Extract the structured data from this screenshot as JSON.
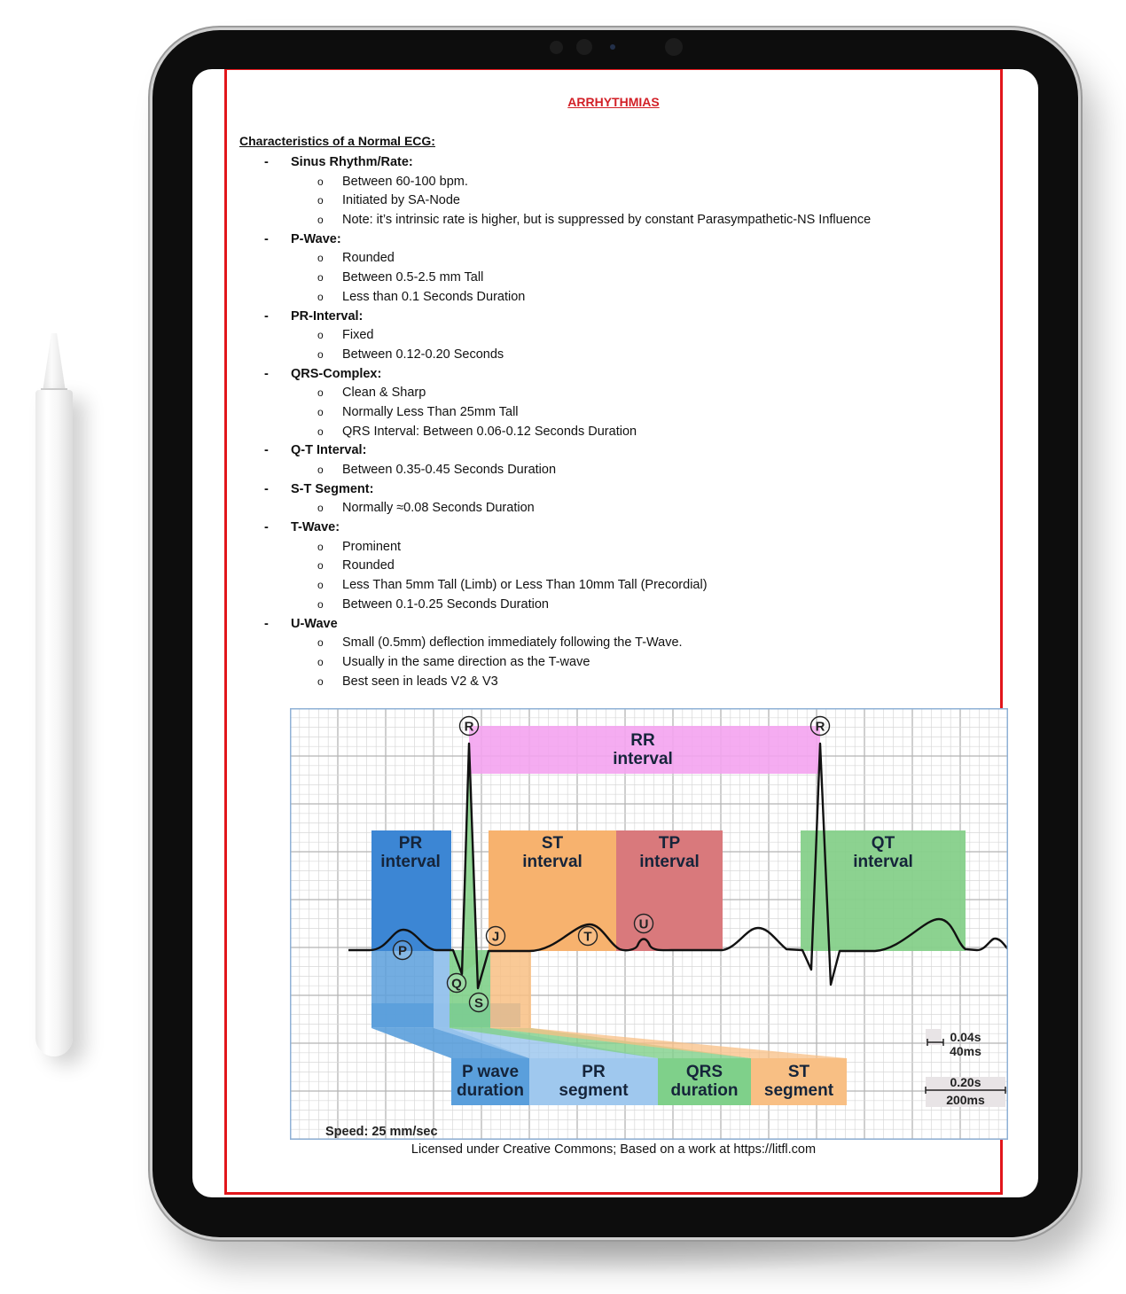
{
  "document": {
    "title": "ARRHYTHMIAS",
    "heading": "Characteristics of a Normal ECG:",
    "sections": [
      {
        "label": "Sinus Rhythm/Rate:",
        "items": [
          "Between 60-100 bpm.",
          "Initiated by SA-Node",
          "Note: it’s intrinsic rate is higher, but is suppressed by constant Parasympathetic-NS Influence"
        ]
      },
      {
        "label": "P-Wave:",
        "items": [
          "Rounded",
          "Between 0.5-2.5 mm Tall",
          "Less than 0.1 Seconds Duration"
        ]
      },
      {
        "label": "PR-Interval:",
        "items": [
          "Fixed",
          "Between 0.12-0.20 Seconds"
        ]
      },
      {
        "label": "QRS-Complex:",
        "items": [
          "Clean & Sharp",
          "Normally Less Than 25mm Tall",
          "QRS Interval: Between 0.06-0.12 Seconds Duration"
        ]
      },
      {
        "label": "Q-T Interval:",
        "items": [
          "Between 0.35-0.45 Seconds Duration"
        ]
      },
      {
        "label": "S-T Segment:",
        "items": [
          "Normally ≈0.08 Seconds Duration"
        ]
      },
      {
        "label": "T-Wave:",
        "items": [
          "Prominent",
          "Rounded",
          "Less Than 5mm Tall (Limb) or Less Than 10mm Tall (Precordial)",
          "Between 0.1-0.25 Seconds Duration"
        ]
      },
      {
        "label": "U-Wave",
        "items": [
          "Small (0.5mm) deflection immediately following the T-Wave.",
          "Usually in the same direction as the T-wave",
          "Best seen in leads V2 & V3"
        ]
      }
    ],
    "bullet_dash": "-",
    "bullet_sub": "o",
    "caption": "Licensed under Creative Commons; Based on a work at https://litfl.com"
  },
  "ecg_figure": {
    "speed_label": "Speed: 25 mm/sec",
    "wave_markers": [
      "P",
      "Q",
      "R",
      "S",
      "J",
      "T",
      "U",
      "R"
    ],
    "upper_boxes": [
      {
        "line1": "RR",
        "line2": "interval",
        "color": "#f4a3f0"
      },
      {
        "line1": "PR",
        "line2": "interval",
        "color": "#3c86d4"
      },
      {
        "line1": "ST",
        "line2": "interval",
        "color": "#f7b26e"
      },
      {
        "line1": "TP",
        "line2": "interval",
        "color": "#d9797c"
      },
      {
        "line1": "QT",
        "line2": "interval",
        "color": "#86d08a"
      }
    ],
    "lower_boxes": [
      {
        "line1": "P wave",
        "line2": "duration",
        "color": "#5a9fdc"
      },
      {
        "line1": "PR",
        "line2": "segment",
        "color": "#9fc8ee"
      },
      {
        "line1": "QRS",
        "line2": "duration",
        "color": "#7fd08a"
      },
      {
        "line1": "ST",
        "line2": "segment",
        "color": "#f8bf84"
      }
    ],
    "scale": {
      "small_top": "0.04s",
      "small_bottom": "40ms",
      "large_top": "0.20s",
      "large_bottom": "200ms"
    },
    "colors": {
      "grid_minor": "#d8d8d8",
      "grid_major": "#b5b5b5",
      "frame": "#8fb1d6",
      "trace": "#111111"
    }
  }
}
